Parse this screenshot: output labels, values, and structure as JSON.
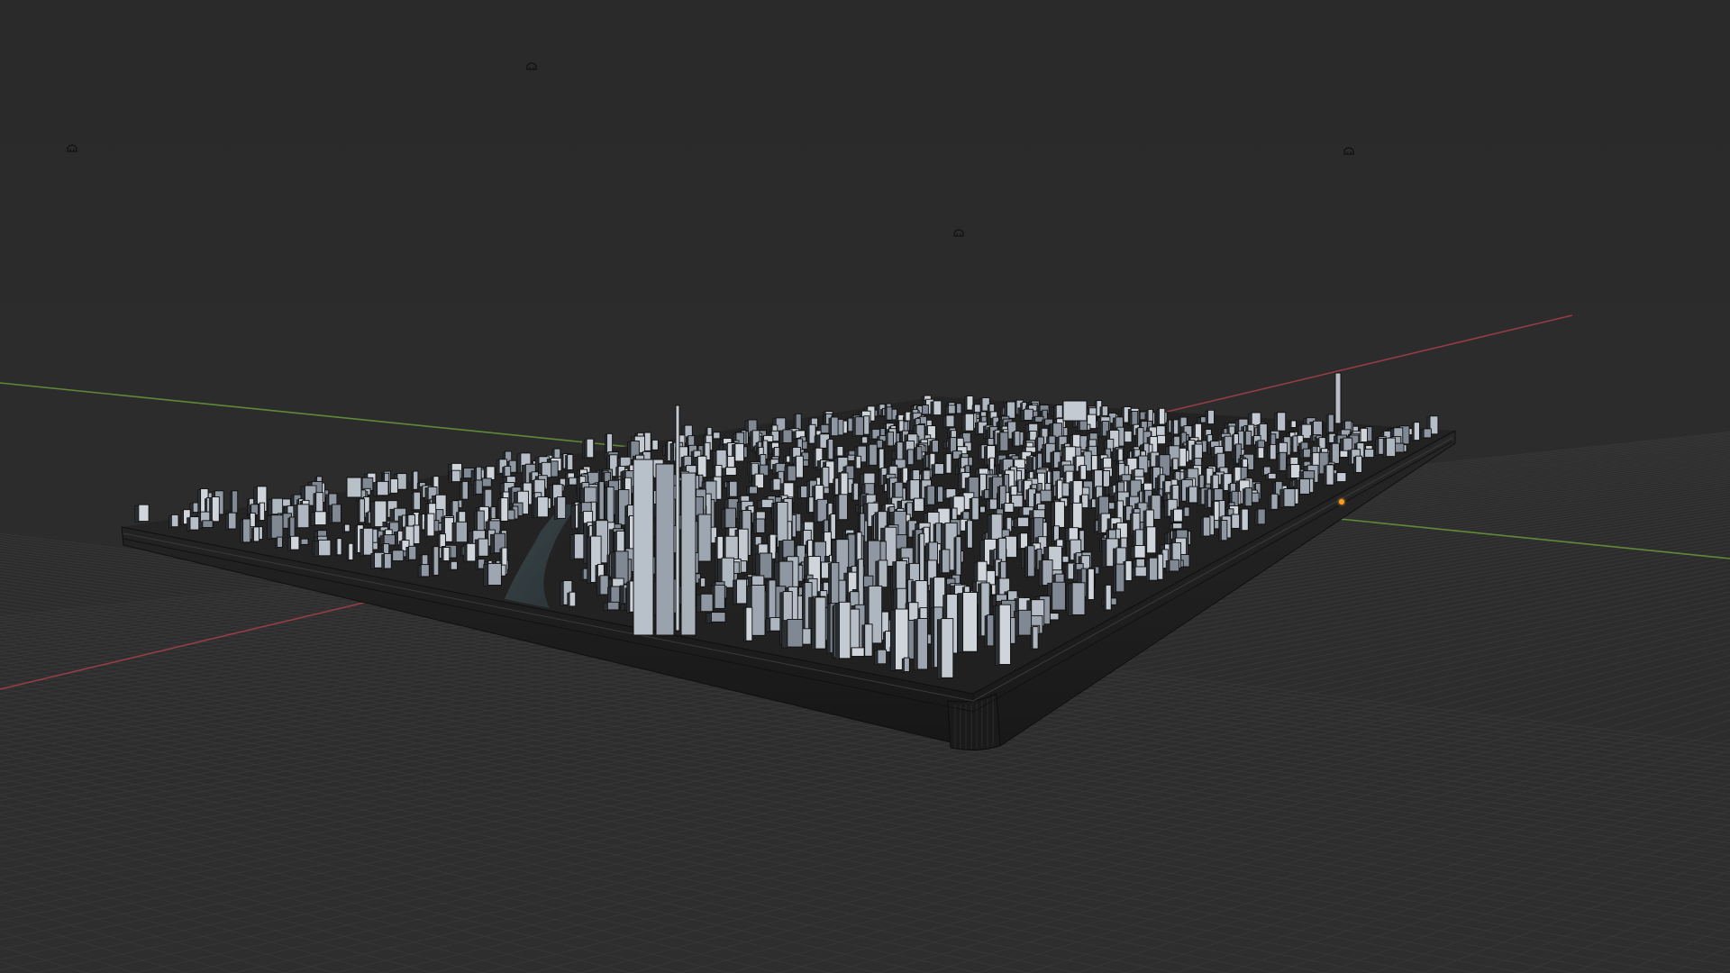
{
  "app": {
    "name": "3D viewport",
    "mode": "solid-shading"
  },
  "scene": {
    "background_color": "#2b2b2b",
    "grid_color": "#3a3a3a",
    "x_axis_color": "#b0404c",
    "y_axis_color": "#6a9a3a",
    "object": "city-block-model",
    "building_color": "#aeb6c0",
    "base_color": "#1c1c1c",
    "origin_color": "#ff9a1a"
  },
  "lights": [
    {
      "icon": "light-icon"
    },
    {
      "icon": "light-icon"
    },
    {
      "icon": "light-icon"
    },
    {
      "icon": "light-icon"
    }
  ]
}
